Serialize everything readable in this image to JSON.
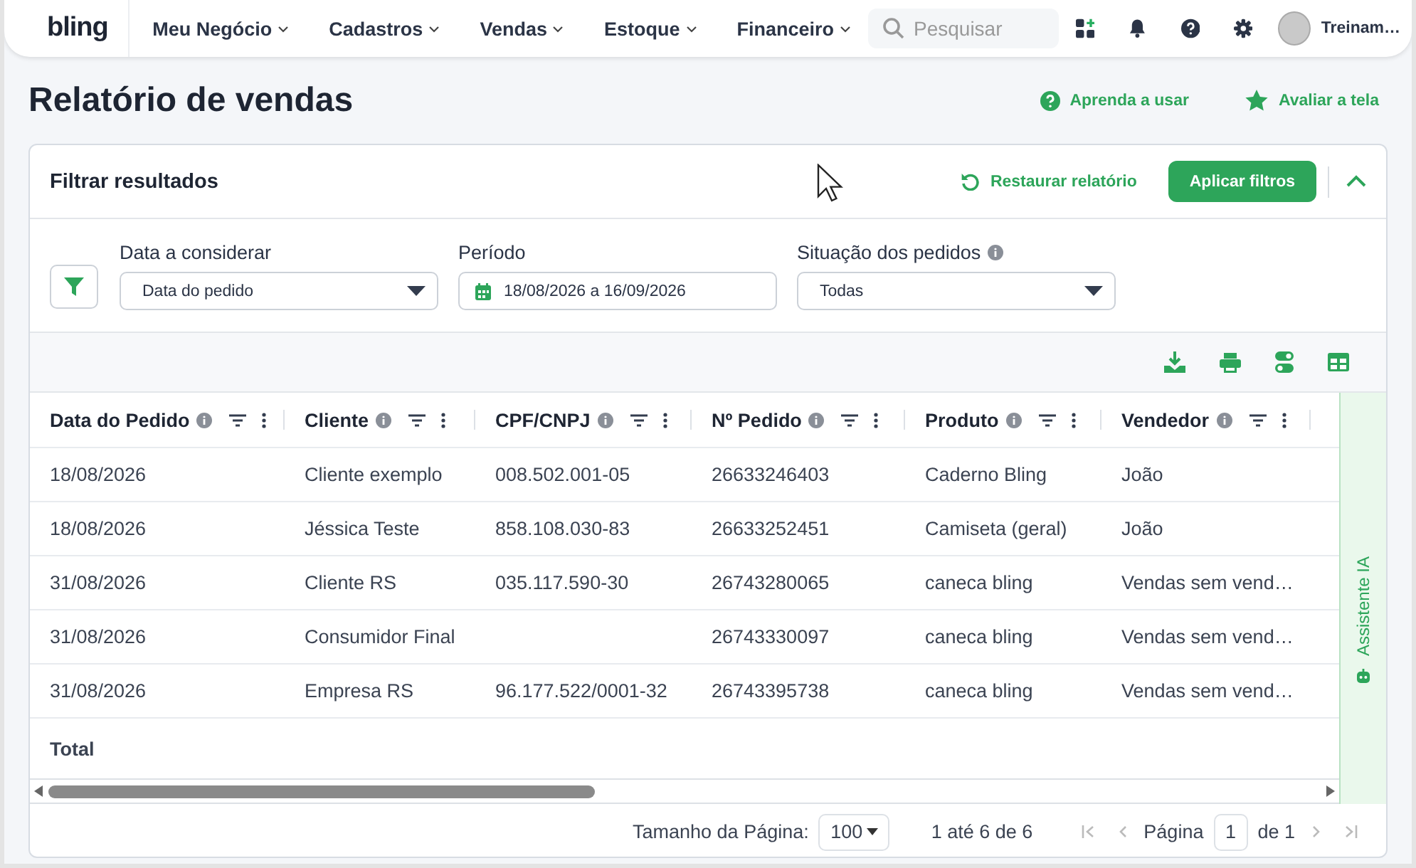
{
  "nav": {
    "logo": "bling",
    "items": [
      {
        "label": "Meu Negócio"
      },
      {
        "label": "Cadastros"
      },
      {
        "label": "Vendas"
      },
      {
        "label": "Estoque"
      },
      {
        "label": "Financeiro"
      }
    ],
    "search": {
      "placeholder": "Pesquisar"
    },
    "user": "Treinam…"
  },
  "page": {
    "title": "Relatório de vendas",
    "actions": [
      {
        "kind": "help",
        "label": "Aprenda a usar"
      },
      {
        "kind": "star",
        "label": "Avaliar a tela"
      }
    ]
  },
  "filters": {
    "title": "Filtrar resultados",
    "restore": "Restaurar relatório",
    "apply": "Aplicar filtros",
    "expanded": true,
    "fields": [
      {
        "kind": "select",
        "label": "Data a considerar",
        "value": "Data do pedido",
        "info": false
      },
      {
        "kind": "date",
        "label": "Período",
        "value": "18/08/2026 a 16/09/2026",
        "info": false
      },
      {
        "kind": "select",
        "label": "Situação dos pedidos",
        "value": "Todas",
        "info": true
      }
    ]
  },
  "table": {
    "columns": [
      {
        "label": "Data do Pedido"
      },
      {
        "label": "Cliente"
      },
      {
        "label": "CPF/CNPJ"
      },
      {
        "label": "Nº Pedido"
      },
      {
        "label": "Produto"
      },
      {
        "label": "Vendedor"
      }
    ],
    "rows": [
      [
        "18/08/2026",
        "Cliente exemplo",
        "008.502.001-05",
        "26633246403",
        "Caderno Bling",
        "João"
      ],
      [
        "18/08/2026",
        "Jéssica Teste",
        "858.108.030-83",
        "26633252451",
        "Camiseta (geral)",
        "João"
      ],
      [
        "31/08/2026",
        "Cliente RS",
        "035.117.590-30",
        "26743280065",
        "caneca bling",
        "Vendas sem vend…"
      ],
      [
        "31/08/2026",
        "Consumidor Final",
        "",
        "26743330097",
        "caneca bling",
        "Vendas sem vend…"
      ],
      [
        "31/08/2026",
        "Empresa RS",
        "96.177.522/0001-32",
        "26743395738",
        "caneca bling",
        "Vendas sem vend…"
      ]
    ],
    "total": "Total"
  },
  "pagination": {
    "size_label": "Tamanho da Página:",
    "size": "100",
    "range": "1 até 6 de 6",
    "page_label": "Página",
    "page": "1",
    "of": "de 1"
  },
  "assistant": "Assistente IA"
}
